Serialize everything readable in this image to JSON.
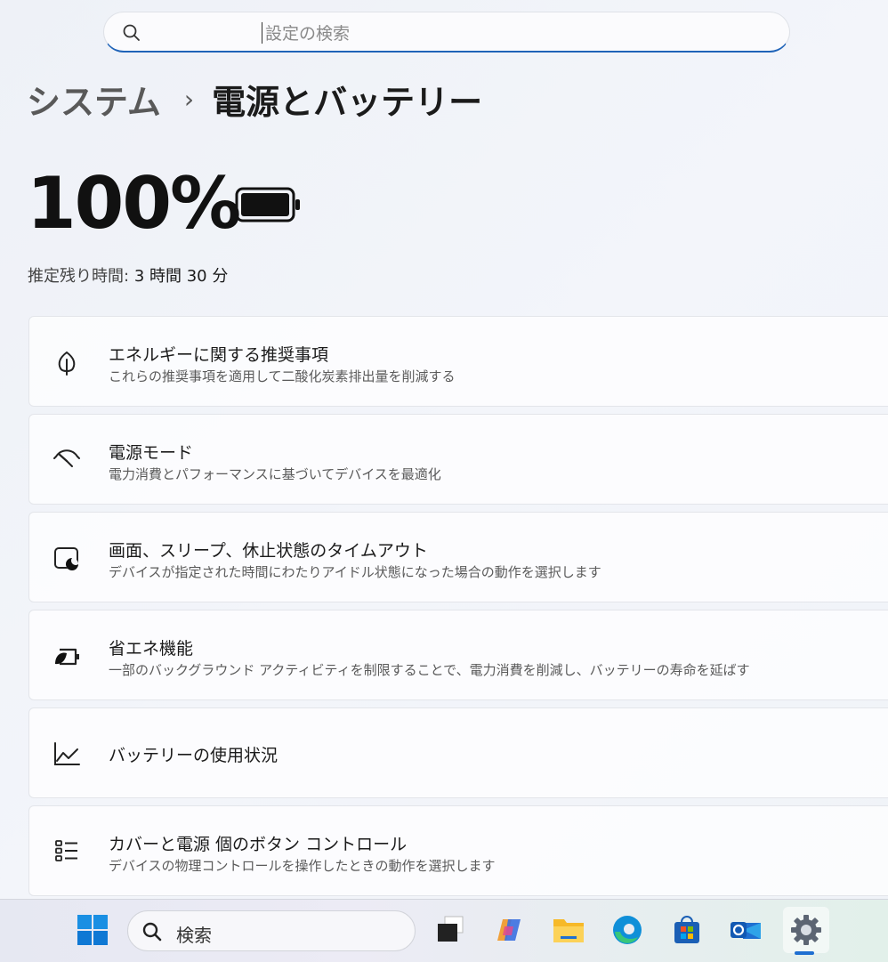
{
  "search": {
    "placeholder": "設定の検索",
    "icon": "search-icon"
  },
  "breadcrumb": {
    "parent": "システム",
    "separator": "›",
    "current": "電源とバッテリー"
  },
  "battery": {
    "percent_text": "100%",
    "level": 1.0,
    "remaining_label": "推定残り時間:",
    "remaining_value": "3 時間 30 分"
  },
  "cards": [
    {
      "icon": "leaf-icon",
      "title": "エネルギーに関する推奨事項",
      "desc": "これらの推奨事項を適用して二酸化炭素排出量を削減する"
    },
    {
      "icon": "gauge-icon",
      "title": "電源モード",
      "desc": "電力消費とパフォーマンスに基づいてデバイスを最適化"
    },
    {
      "icon": "screen-sleep-icon",
      "title": "画面、スリープ、休止状態のタイムアウト",
      "desc": "デバイスが指定された時間にわたりアイドル状態になった場合の動作を選択します"
    },
    {
      "icon": "energy-saver-icon",
      "title": "省エネ機能",
      "desc": "一部のバックグラウンド アクティビティを制限することで、電力消費を削減し、バッテリーの寿命を延ばす"
    },
    {
      "icon": "usage-chart-icon",
      "title": "バッテリーの使用状況",
      "desc": ""
    },
    {
      "icon": "list-icon",
      "title": "カバーと電源 個のボタン コントロール",
      "desc": "デバイスの物理コントロールを操作したときの動作を選択します"
    }
  ],
  "taskbar": {
    "search_label": "検索",
    "apps": [
      "start-icon",
      "task-view-icon",
      "copilot-icon",
      "file-explorer-icon",
      "edge-icon",
      "store-icon",
      "outlook-icon",
      "settings-icon"
    ]
  },
  "colors": {
    "accent": "#1f63b8",
    "indicator": "#1f6fd1"
  }
}
